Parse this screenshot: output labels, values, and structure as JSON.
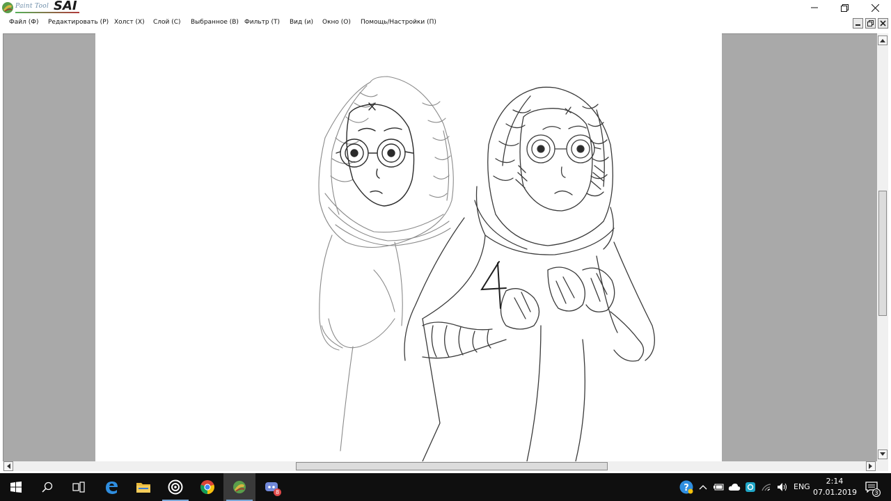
{
  "app": {
    "logo_small": "Paint Tool",
    "logo_big": "SAI",
    "icon": "sai-logo-icon"
  },
  "window_controls": {
    "minimize_icon": "minimize-icon",
    "restore_icon": "restore-icon",
    "close_icon": "close-icon"
  },
  "menu": {
    "items": [
      {
        "label": "Файл (Ф)"
      },
      {
        "label": "Редактировать (Р)"
      },
      {
        "label": "Холст (Х)"
      },
      {
        "label": "Слой (С)"
      },
      {
        "label": "Выбранное (В)"
      },
      {
        "label": "Фильтр (Т)"
      },
      {
        "label": "Вид (и)"
      },
      {
        "label": "Окно (О)"
      },
      {
        "label": "Помощь/Настройки (П)"
      }
    ]
  },
  "canvas": {
    "drawing_number": "4"
  },
  "scrollbars": {
    "vertical_position": 0.37,
    "horizontal_position": 0.34
  },
  "taskbar": {
    "apps": [
      {
        "name": "start",
        "icon": "windows-start-icon"
      },
      {
        "name": "search",
        "icon": "search-icon"
      },
      {
        "name": "task-view",
        "icon": "task-view-icon"
      },
      {
        "name": "edge",
        "icon": "edge-icon"
      },
      {
        "name": "explorer",
        "icon": "folder-icon"
      },
      {
        "name": "target-app",
        "icon": "target-icon"
      },
      {
        "name": "chrome",
        "icon": "chrome-icon"
      },
      {
        "name": "paint-tool-sai",
        "icon": "sai-icon"
      },
      {
        "name": "discord",
        "icon": "discord-icon",
        "badge": "8"
      }
    ],
    "tray": {
      "help_icon": "help-icon",
      "chevron_icon": "chevron-up-icon",
      "battery_icon": "battery-icon",
      "onedrive_icon": "cloud-icon",
      "app_icon": "tray-app-icon",
      "network_icon": "wifi-icon",
      "volume_icon": "volume-icon",
      "language": "ENG",
      "time": "2:14",
      "date": "07.01.2019",
      "notifications_icon": "notifications-icon",
      "notifications_count": "3"
    }
  }
}
